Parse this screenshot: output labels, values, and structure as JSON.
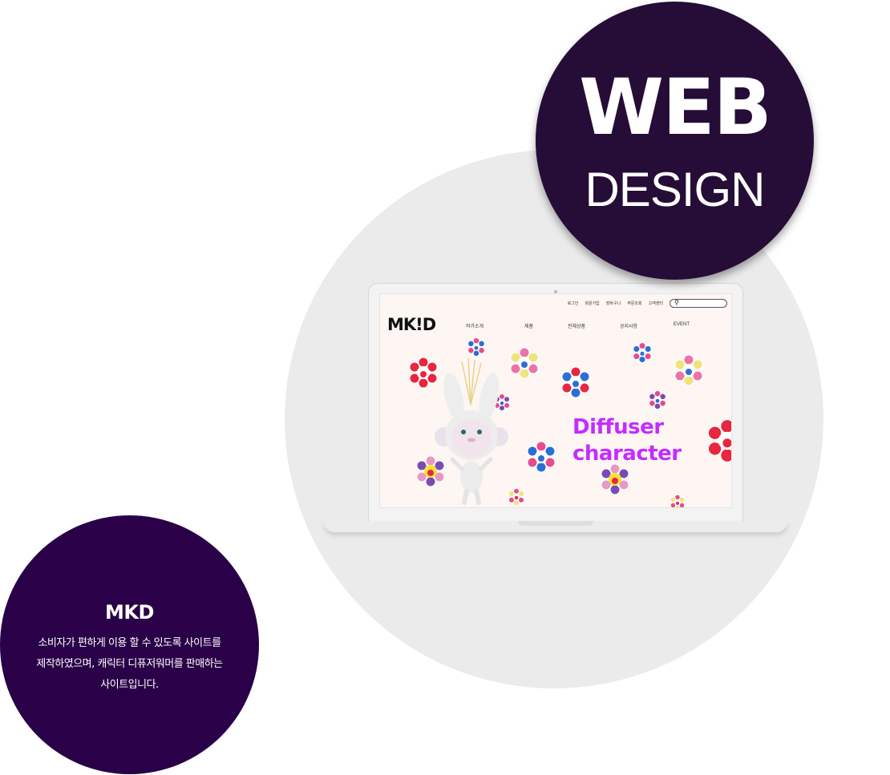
{
  "badge": {
    "line1": "WEB",
    "line2": "DESIGN"
  },
  "site": {
    "util_links": [
      "로그인",
      "회원가입",
      "장바구니",
      "주문조회",
      "고객센터"
    ],
    "logo": "MK!D",
    "nav": [
      "작가소개",
      "제품",
      "전체상품",
      "공지사항",
      "EVENT"
    ],
    "hero": {
      "line1": "Diffuser",
      "line2": "character"
    }
  },
  "info": {
    "title": "MKD",
    "desc_lines": [
      "소비자가 편하게 이용 할 수 있도록 사이트를",
      "제작하였으며, 캐릭터 디퓨저워머를 판매하는",
      "사이트입니다."
    ]
  },
  "colors": {
    "badge_bg": "#250d37",
    "info_bg": "#2a0048",
    "hero_text": "#c52cff",
    "screen_bg": "#fdf6f3"
  }
}
